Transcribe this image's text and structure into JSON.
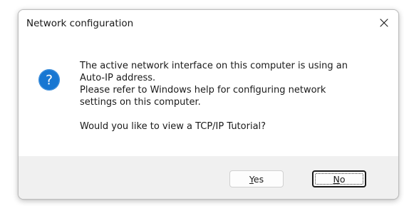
{
  "window": {
    "title": "Network configuration",
    "close_glyph": "✕"
  },
  "message": {
    "lines": [
      "The active network interface on this computer is using an",
      "Auto-IP address.",
      "Please refer to Windows help for configuring network",
      "settings on this computer."
    ],
    "question": "Would you like to view a TCP/IP Tutorial?"
  },
  "icon": {
    "name": "question-icon",
    "glyph": "?",
    "color": "#1877d2"
  },
  "buttons": {
    "yes": {
      "mnemonic": "Y",
      "rest": "es"
    },
    "no": {
      "mnemonic": "N",
      "rest": "o"
    }
  }
}
